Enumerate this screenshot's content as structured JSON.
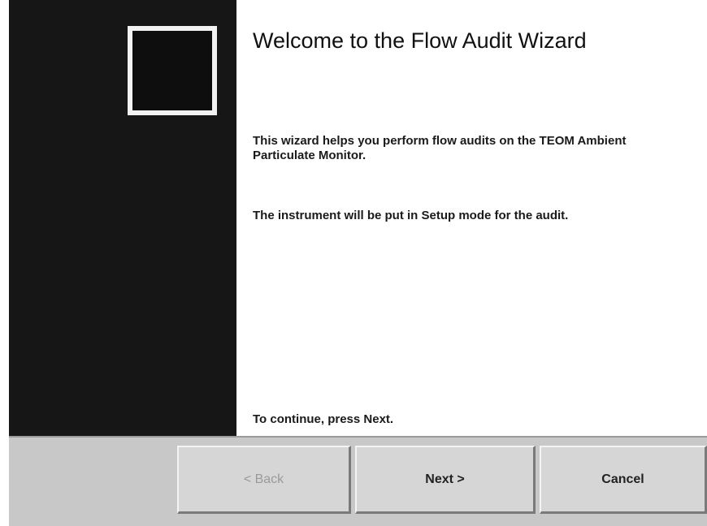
{
  "wizard": {
    "title": "Welcome to the Flow Audit Wizard",
    "paragraphs": [
      "This wizard helps you perform flow audits on the TEOM Ambient Particulate Monitor.",
      "The instrument will be put in Setup mode for the audit.",
      "To continue, press Next."
    ],
    "logo_icon": "framed-square-logo"
  },
  "buttons": {
    "back_label": "< Back",
    "back_enabled": false,
    "next_label": "Next >",
    "cancel_label": "Cancel"
  },
  "colors": {
    "side_panel": "#161616",
    "footer": "#c8c8c8",
    "button_face": "#d6d6d6",
    "disabled_text": "#9a9a9a"
  }
}
